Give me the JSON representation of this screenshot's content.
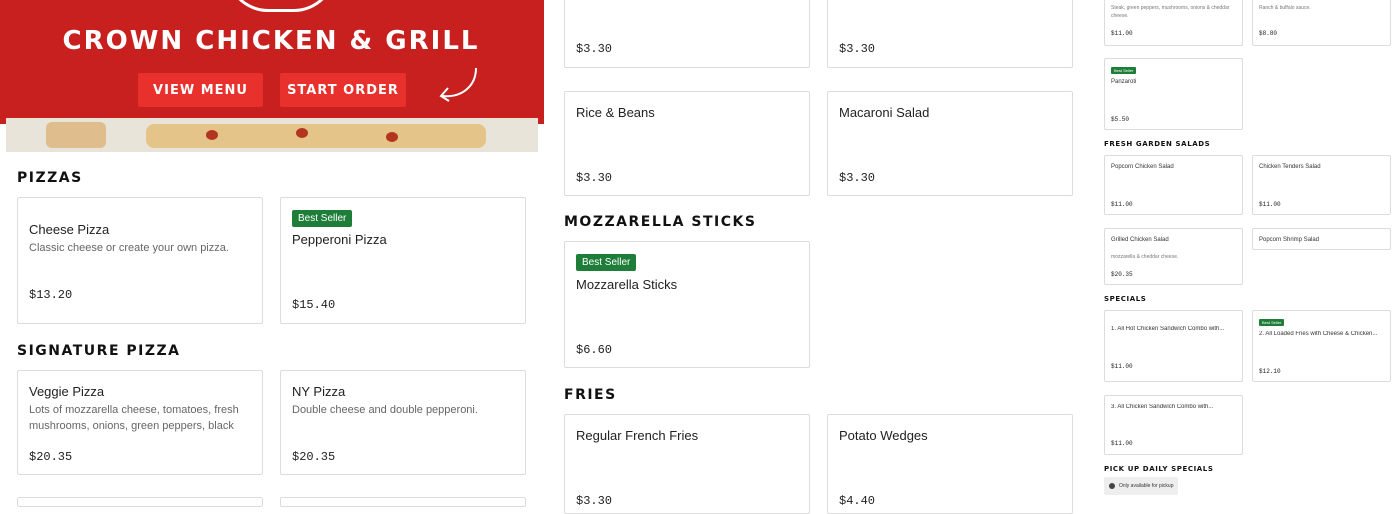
{
  "hero": {
    "title": "CROWN CHICKEN & GRILL",
    "view_menu": "VIEW MENU",
    "start_order": "START ORDER"
  },
  "col1": {
    "pizzas": {
      "heading": "PIZZAS",
      "items": [
        {
          "name": "Cheese Pizza",
          "desc": "Classic cheese or create your own pizza.",
          "price": "$13.20"
        },
        {
          "badge": "Best Seller",
          "name": "Pepperoni Pizza",
          "price": "$15.40"
        }
      ]
    },
    "signature": {
      "heading": "SIGNATURE PIZZA",
      "items": [
        {
          "name": "Veggie Pizza",
          "desc": "Lots of mozzarella cheese, tomatoes, fresh mushrooms, onions, green peppers, black olive...",
          "price": "$20.35"
        },
        {
          "name": "NY Pizza",
          "desc": "Double cheese and double pepperoni.",
          "price": "$20.35"
        }
      ]
    }
  },
  "col2": {
    "top": [
      {
        "price": "$3.30"
      },
      {
        "price": "$3.30"
      }
    ],
    "sides": [
      {
        "name": "Rice & Beans",
        "price": "$3.30"
      },
      {
        "name": "Macaroni Salad",
        "price": "$3.30"
      }
    ],
    "mozz": {
      "heading": "MOZZARELLA STICKS",
      "items": [
        {
          "badge": "Best Seller",
          "name": "Mozzarella Sticks",
          "price": "$6.60"
        }
      ]
    },
    "fries": {
      "heading": "FRIES",
      "items": [
        {
          "name": "Regular French Fries",
          "price": "$3.30"
        },
        {
          "name": "Potato Wedges",
          "price": "$4.40"
        }
      ]
    }
  },
  "col3": {
    "top": [
      {
        "desc": "Steak, green peppers, mushrooms, onions & cheddar cheese.",
        "price": "$11.00"
      },
      {
        "desc": "Ranch & buffalo sauce.",
        "price": "$8.80"
      }
    ],
    "panzaroti": {
      "badge": "Best Seller",
      "name": "Panzaroti",
      "price": "$5.50"
    },
    "salads": {
      "heading": "FRESH GARDEN SALADS",
      "items": [
        {
          "name": "Popcorn Chicken Salad",
          "price": "$11.00"
        },
        {
          "name": "Chicken Tenders Salad",
          "price": "$11.00"
        },
        {
          "name": "Grilled Chicken Salad",
          "desc": "mozzarella & cheddar cheese.",
          "price": "$20.35"
        },
        {
          "name": "Popcorn Shrimp Salad"
        }
      ]
    },
    "specials": {
      "heading": "SPECIALS",
      "items": [
        {
          "name": "1. All Hot Chicken Sandwich Combo with...",
          "price": "$11.00"
        },
        {
          "badge": "Best Seller",
          "name": "2. All Loaded Fries with Cheese & Chicken...",
          "price": "$12.10"
        },
        {
          "name": "3. All Chicken Sandwich Combo with...",
          "price": "$11.00"
        }
      ]
    },
    "pickup": {
      "heading": "PICK UP DAILY SPECIALS",
      "note": "Only available for pickup"
    }
  }
}
